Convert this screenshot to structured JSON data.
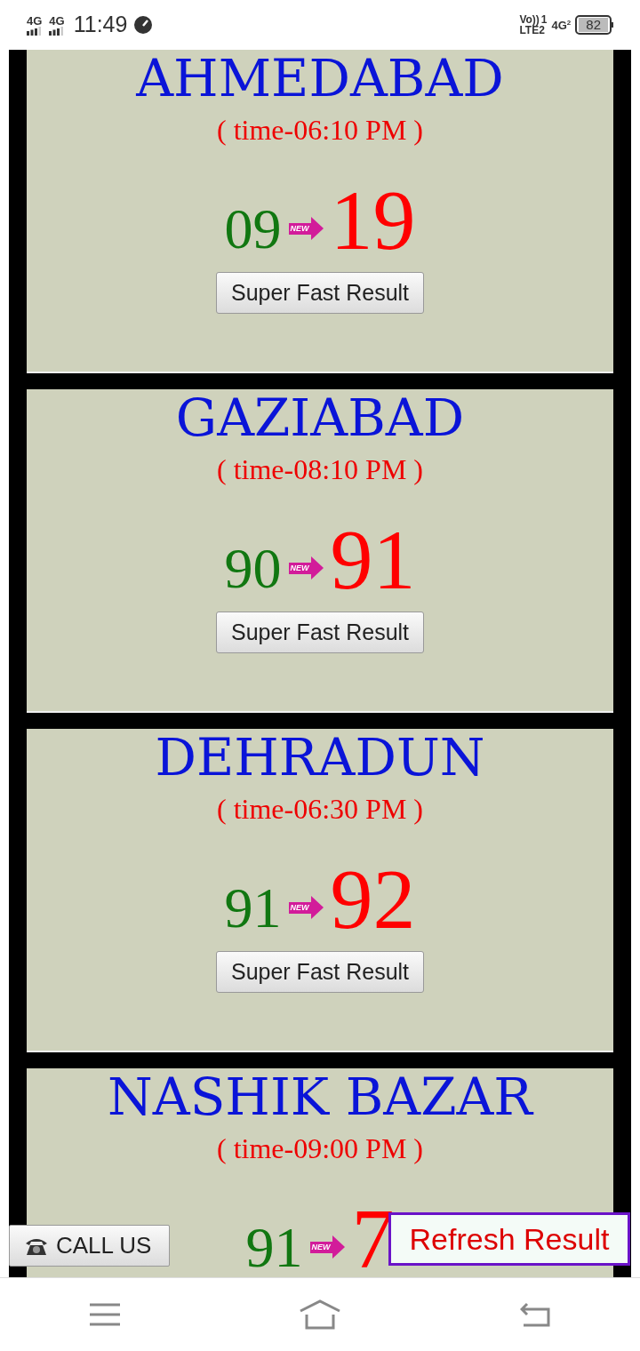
{
  "status_bar": {
    "network_1": "4G",
    "network_2": "4G",
    "time": "11:49",
    "volte": "Vo))",
    "sim": "1",
    "lte": "LTE2",
    "network_3": "4G",
    "network_3_sub": "2",
    "battery": "82"
  },
  "results": [
    {
      "city": "AHMEDABAD",
      "time": "( time-06:10 PM )",
      "old": "09",
      "badge": "NEW",
      "new": "19",
      "button": "Super Fast Result"
    },
    {
      "city": "GAZIABAD",
      "time": "( time-08:10 PM )",
      "old": "90",
      "badge": "NEW",
      "new": "91",
      "button": "Super Fast Result"
    },
    {
      "city": "DEHRADUN",
      "time": "( time-06:30 PM )",
      "old": "91",
      "badge": "NEW",
      "new": "92",
      "button": "Super Fast Result"
    },
    {
      "city": "NASHIK BAZAR",
      "time": "( time-09:00 PM )",
      "old": "91",
      "badge": "NEW",
      "new": "7"
    }
  ],
  "call_button": "CALL US",
  "refresh_button": "Refresh Result"
}
